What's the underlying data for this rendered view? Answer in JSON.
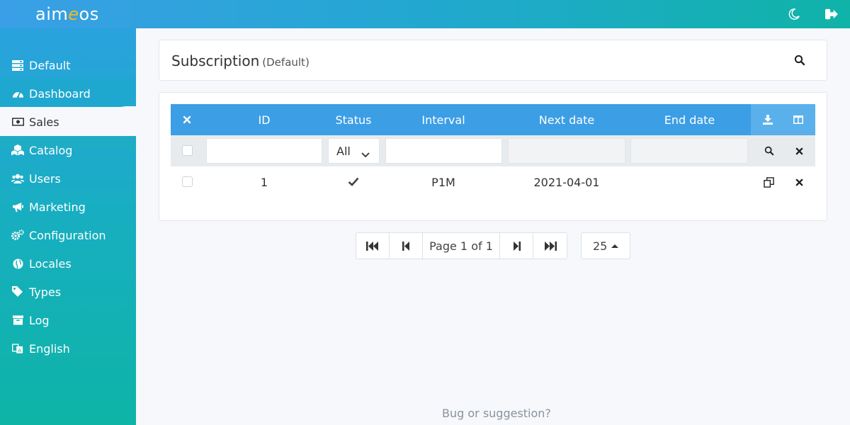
{
  "brand": {
    "logo_prefix": "aim",
    "logo_e": "e",
    "logo_suffix": "os"
  },
  "topbar": {
    "theme_icon": "moon-icon",
    "logout_icon": "sign-out-icon"
  },
  "sidebar": {
    "items": [
      {
        "label": "Default",
        "icon": "server-icon"
      },
      {
        "label": "Dashboard",
        "icon": "dashboard-gauge-icon"
      },
      {
        "label": "Sales",
        "icon": "money-bill-icon",
        "active": true
      },
      {
        "label": "Catalog",
        "icon": "cubes-icon"
      },
      {
        "label": "Users",
        "icon": "users-icon"
      },
      {
        "label": "Marketing",
        "icon": "megaphone-icon"
      },
      {
        "label": "Configuration",
        "icon": "cogs-icon"
      },
      {
        "label": "Locales",
        "icon": "globe-icon"
      },
      {
        "label": "Types",
        "icon": "tags-icon"
      },
      {
        "label": "Log",
        "icon": "archive-box-icon"
      },
      {
        "label": "English",
        "icon": "language-icon"
      }
    ]
  },
  "header": {
    "title": "Subscription",
    "subtitle": "(Default)"
  },
  "table": {
    "columns": [
      "ID",
      "Status",
      "Interval",
      "Next date",
      "End date"
    ],
    "filter": {
      "status_select": "All"
    },
    "rows": [
      {
        "id": "1",
        "status": "check-icon",
        "interval": "P1M",
        "next_date": "2021-04-01",
        "end_date": ""
      }
    ]
  },
  "pagination": {
    "page_label": "Page 1 of 1",
    "page_size": "25"
  },
  "footer": {
    "link": "Bug or suggestion?"
  },
  "colors": {
    "header_blue": "#3c9ee5",
    "teal": "#0eb4a6",
    "accent_logo": "#f5b820"
  }
}
